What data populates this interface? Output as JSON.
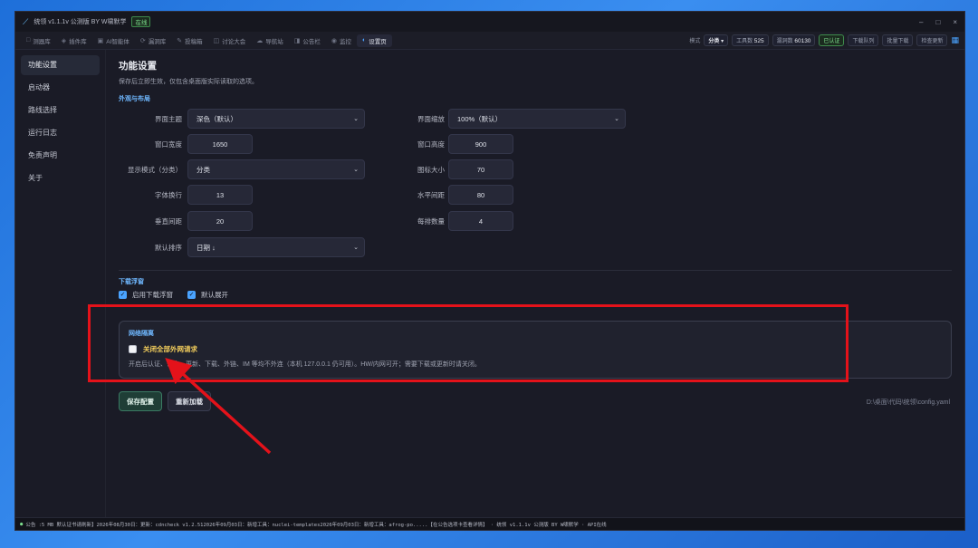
{
  "window": {
    "title": "统领 v1.1.1v 公测版 BY W啸默学",
    "status_badge": "在线"
  },
  "tabs": [
    {
      "icon": "□",
      "label": "测器库"
    },
    {
      "icon": "◈",
      "label": "插件库"
    },
    {
      "icon": "▣",
      "label": "AI智能体"
    },
    {
      "icon": "⟳",
      "label": "漏洞库"
    },
    {
      "icon": "✎",
      "label": "投稿箱"
    },
    {
      "icon": "◫",
      "label": "讨论大会"
    },
    {
      "icon": "☁",
      "label": "导航站"
    },
    {
      "icon": "◨",
      "label": "公告栏"
    },
    {
      "icon": "◉",
      "label": "监控"
    },
    {
      "icon": "◐",
      "label": "设置页"
    }
  ],
  "rightbar": {
    "mode_label": "模式",
    "mode_value": "分类 ▾",
    "tool_count_label": "工具数",
    "tool_count": "525",
    "vuln_count_label": "漏洞数",
    "vuln_count": "60130",
    "verified": "已认证",
    "download_queue": "下载队列",
    "batch_download": "批量下载",
    "check_update": "检查更新"
  },
  "sidebar": {
    "items": [
      "功能设置",
      "启动器",
      "路线选择",
      "运行日志",
      "免责声明",
      "关于"
    ]
  },
  "main": {
    "title": "功能设置",
    "subtitle": "保存后立即生效，仅包含桌面版实际读取的选项。",
    "section_layout": "外观与布局",
    "theme_label": "界面主题",
    "theme_value": "深色（默认）",
    "scale_label": "界面缩放",
    "scale_value": "100%（默认）",
    "width_label": "窗口宽度",
    "width_value": "1650",
    "height_label": "窗口高度",
    "height_value": "900",
    "display_mode_label": "显示模式（分类）",
    "display_mode_value": "分类",
    "icon_size_label": "图标大小",
    "icon_size_value": "70",
    "font_wrap_label": "字体换行",
    "font_wrap_value": "13",
    "h_spacing_label": "水平间距",
    "h_spacing_value": "80",
    "v_spacing_label": "垂直间距",
    "v_spacing_value": "20",
    "per_row_label": "每排数量",
    "per_row_value": "4",
    "sort_label": "默认排序",
    "sort_value": "日期 ↓",
    "section_download": "下载浮窗",
    "enable_float": "启用下载浮窗",
    "default_expand": "默认展开",
    "section_network": "网络隔离",
    "block_external": "关闭全部外网请求",
    "network_desc": "开启后认证、公告、更新、下载、外链、IM 等均不外连（本机 127.0.0.1 仍可用）。HW/内网可开；需要下载或更新时请关闭。",
    "save_button": "保存配置",
    "reload_button": "重新加载",
    "config_path": "D:\\桌面\\代码\\统领\\config.yaml"
  },
  "statusbar": {
    "text": "公告 :5 MB 默认证书请刷新】2026年08月30日：更新：cdncheck v1.2.512026年09月03日：新增工具：nuclei-templates2026年09月03日：新增工具：afrog-po.....【在公告选项卡查看详情】 · 统领 v1.1.1v 公测版 BY W啸默学 · API在线"
  },
  "colors": {
    "accent": "#4aa3ff",
    "annotation_red": "#e4121a",
    "warning_text": "#f2cd5c",
    "online_green": "#7ee08f"
  }
}
